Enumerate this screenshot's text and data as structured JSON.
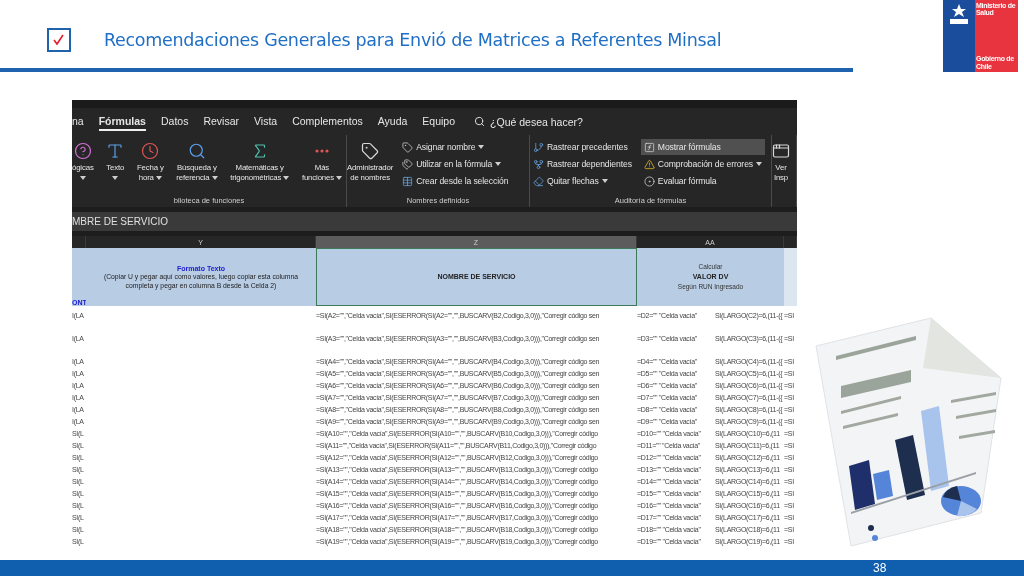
{
  "slide": {
    "title": "Recomendaciones Generales para Envió de Matrices a Referentes Minsal",
    "page_number": "38"
  },
  "logo": {
    "top_text": "Ministerio de Salud",
    "bottom_text": "Gobierno de Chile"
  },
  "excel": {
    "ribbon_tabs": [
      {
        "label": "na",
        "selected": false
      },
      {
        "label": "Fórmulas",
        "selected": true
      },
      {
        "label": "Datos",
        "selected": false
      },
      {
        "label": "Revisar",
        "selected": false
      },
      {
        "label": "Vista",
        "selected": false
      },
      {
        "label": "Complementos",
        "selected": false
      },
      {
        "label": "Ayuda",
        "selected": false
      },
      {
        "label": "Equipo",
        "selected": false
      }
    ],
    "search_placeholder": "¿Qué desea hacer?",
    "groups": [
      {
        "label": "blioteca de funciones",
        "items": [
          {
            "kind": "large",
            "lines": [
              "ógicas"
            ],
            "dropdown": true
          },
          {
            "kind": "large",
            "lines": [
              "Texto"
            ],
            "dropdown": true
          },
          {
            "kind": "large",
            "lines": [
              "Fecha y",
              "hora"
            ],
            "dropdown": true
          },
          {
            "kind": "large",
            "lines": [
              "Búsqueda y",
              "referencia"
            ],
            "dropdown": true
          },
          {
            "kind": "large",
            "lines": [
              "Matemáticas y",
              "trigonométricas"
            ],
            "dropdown": true
          },
          {
            "kind": "large",
            "lines": [
              "Más",
              "funciones"
            ],
            "dropdown": true
          }
        ]
      },
      {
        "label": "Nombres definidos",
        "items": [
          {
            "kind": "large",
            "lines": [
              "Administrador",
              "de nombres"
            ],
            "dropdown": false
          },
          {
            "kind": "small",
            "label": "Asignar nombre",
            "dropdown": true,
            "selected": false
          },
          {
            "kind": "small",
            "label": "Utilizar en la fórmula",
            "dropdown": true,
            "selected": false
          },
          {
            "kind": "small",
            "label": "Crear desde la selección",
            "dropdown": false,
            "selected": false
          }
        ]
      },
      {
        "label": "Auditoría de fórmulas",
        "items": [
          {
            "kind": "small",
            "label": "Rastrear precedentes",
            "dropdown": false,
            "selected": false
          },
          {
            "kind": "small",
            "label": "Rastrear dependientes",
            "dropdown": false,
            "selected": false
          },
          {
            "kind": "small",
            "label": "Quitar flechas",
            "dropdown": true,
            "selected": false
          },
          {
            "kind": "small",
            "label": "Mostrar fórmulas",
            "dropdown": false,
            "selected": true
          },
          {
            "kind": "small",
            "label": "Comprobación de errores",
            "dropdown": true,
            "selected": false
          },
          {
            "kind": "small",
            "label": "Evaluar fórmula",
            "dropdown": false,
            "selected": false
          }
        ]
      },
      {
        "items": [
          {
            "kind": "large",
            "lines": [
              "Ver",
              "Insp"
            ],
            "dropdown": false
          }
        ]
      }
    ],
    "name_box": "MBRE DE SERVICIO",
    "columns": [
      {
        "label": "Y",
        "selected": false
      },
      {
        "label": "Z",
        "selected": true
      },
      {
        "label": "AA",
        "selected": false
      }
    ],
    "header_row": {
      "stub": "ONT",
      "y_title": "Formato Texto",
      "y_note": "(Copiar U y pegar aquí como valores, luego copiar esta columna completa y pegar en columna B desde la Celda 2)",
      "z": "NOMBRE DE SERVICIO",
      "aa": [
        "Calcular",
        "VALOR DV",
        "Según RUN Ingresado"
      ]
    },
    "rows": [
      {
        "tall": true,
        "cells": [
          "I(LA",
          "=SI(A2=\"\",\"Celda vacía\",SI(ESERROR(SI(A2=\"\",\"\",BUSCARV(B2,Codigo,3,0))),\"Corregir código sen",
          "=D2=\"\" \"Celda vacía\"",
          "SI(LARGO(C2)=6,(11-({",
          "=SI"
        ]
      },
      {
        "tall": true,
        "cells": [
          "I(LA",
          "=SI(A3=\"\",\"Celda vacía\",SI(ESERROR(SI(A3=\"\",\"\",BUSCARV(B3,Codigo,3,0))),\"Corregir código sen",
          "=D3=\"\" \"Celda vacía\"",
          "SI(LARGO(C3)=6,(11-({",
          "=SI"
        ]
      },
      {
        "tall": false,
        "cells": [
          "I(LA",
          "=SI(A4=\"\",\"Celda vacía\",SI(ESERROR(SI(A4=\"\",\"\",BUSCARV(B4,Codigo,3,0))),\"Corregir código sen",
          "=D4=\"\" \"Celda vacía\"",
          "SI(LARGO(C4)=6,(11-({",
          "=SI"
        ]
      },
      {
        "tall": false,
        "cells": [
          "I(LA",
          "=SI(A5=\"\",\"Celda vacía\",SI(ESERROR(SI(A5=\"\",\"\",BUSCARV(B5,Codigo,3,0))),\"Corregir código sen",
          "=D5=\"\" \"Celda vacía\"",
          "SI(LARGO(C5)=6,(11-({",
          "=SI"
        ]
      },
      {
        "tall": false,
        "cells": [
          "I(LA",
          "=SI(A6=\"\",\"Celda vacía\",SI(ESERROR(SI(A6=\"\",\"\",BUSCARV(B6,Codigo,3,0))),\"Corregir código sen",
          "=D6=\"\" \"Celda vacía\"",
          "SI(LARGO(C6)=6,(11-({",
          "=SI"
        ]
      },
      {
        "tall": false,
        "cells": [
          "I(LA",
          "=SI(A7=\"\",\"Celda vacía\",SI(ESERROR(SI(A7=\"\",\"\",BUSCARV(B7,Codigo,3,0))),\"Corregir código sen",
          "=D7=\"\" \"Celda vacía\"",
          "SI(LARGO(C7)=6,(11-({",
          "=SI"
        ]
      },
      {
        "tall": false,
        "cells": [
          "I(LA",
          "=SI(A8=\"\",\"Celda vacía\",SI(ESERROR(SI(A8=\"\",\"\",BUSCARV(B8,Codigo,3,0))),\"Corregir código sen",
          "=D8=\"\" \"Celda vacía\"",
          "SI(LARGO(C8)=6,(11-({",
          "=SI"
        ]
      },
      {
        "tall": false,
        "cells": [
          "I(LA",
          "=SI(A9=\"\",\"Celda vacía\",SI(ESERROR(SI(A9=\"\",\"\",BUSCARV(B9,Codigo,3,0))),\"Corregir código sen",
          "=D9=\"\" \"Celda vacía\"",
          "SI(LARGO(C9)=6,(11-({",
          "=SI"
        ]
      },
      {
        "tall": false,
        "cells": [
          "SI(L",
          "=SI(A10=\"\",\"Celda vacía\",SI(ESERROR(SI(A10=\"\",\"\",BUSCARV(B10,Codigo,3,0))),\"Corregir código",
          "=D10=\"\" \"Celda vacía\"",
          "SI(LARGO(C10)=6,(11",
          "=SI"
        ]
      },
      {
        "tall": false,
        "cells": [
          "SI(L",
          "=SI(A11=\"\",\"Celda vacía\",SI(ESERROR(SI(A11=\"\",\"\",BUSCARV(B11,Codigo,3,0))),\"Corregir código",
          "=D11=\"\" \"Celda vacía\"",
          "SI(LARGO(C11)=6,(11",
          "=SI"
        ]
      },
      {
        "tall": false,
        "cells": [
          "SI(L",
          "=SI(A12=\"\",\"Celda vacía\",SI(ESERROR(SI(A12=\"\",\"\",BUSCARV(B12,Codigo,3,0))),\"Corregir código",
          "=D12=\"\" \"Celda vacía\"",
          "SI(LARGO(C12)=6,(11",
          "=SI"
        ]
      },
      {
        "tall": false,
        "cells": [
          "SI(L",
          "=SI(A13=\"\",\"Celda vacía\",SI(ESERROR(SI(A13=\"\",\"\",BUSCARV(B13,Codigo,3,0))),\"Corregir código",
          "=D13=\"\" \"Celda vacía\"",
          "SI(LARGO(C13)=6,(11",
          "=SI"
        ]
      },
      {
        "tall": false,
        "cells": [
          "SI(L",
          "=SI(A14=\"\",\"Celda vacía\",SI(ESERROR(SI(A14=\"\",\"\",BUSCARV(B14,Codigo,3,0))),\"Corregir código",
          "=D14=\"\" \"Celda vacía\"",
          "SI(LARGO(C14)=6,(11",
          "=SI"
        ]
      },
      {
        "tall": false,
        "cells": [
          "SI(L",
          "=SI(A15=\"\",\"Celda vacía\",SI(ESERROR(SI(A15=\"\",\"\",BUSCARV(B15,Codigo,3,0))),\"Corregir código",
          "=D15=\"\" \"Celda vacía\"",
          "SI(LARGO(C15)=6,(11",
          "=SI"
        ]
      },
      {
        "tall": false,
        "cells": [
          "SI(L",
          "=SI(A16=\"\",\"Celda vacía\",SI(ESERROR(SI(A16=\"\",\"\",BUSCARV(B16,Codigo,3,0))),\"Corregir código",
          "=D16=\"\" \"Celda vacía\"",
          "SI(LARGO(C16)=6,(11",
          "=SI"
        ]
      },
      {
        "tall": false,
        "cells": [
          "SI(L",
          "=SI(A17=\"\",\"Celda vacía\",SI(ESERROR(SI(A17=\"\",\"\",BUSCARV(B17,Codigo,3,0))),\"Corregir código",
          "=D17=\"\" \"Celda vacía\"",
          "SI(LARGO(C17)=6,(11",
          "=SI"
        ]
      },
      {
        "tall": false,
        "cells": [
          "SI(L",
          "=SI(A18=\"\",\"Celda vacía\",SI(ESERROR(SI(A18=\"\",\"\",BUSCARV(B18,Codigo,3,0))),\"Corregir código",
          "=D18=\"\" \"Celda vacía\"",
          "SI(LARGO(C18)=6,(11",
          "=SI"
        ]
      },
      {
        "tall": false,
        "cells": [
          "SI(L",
          "=SI(A19=\"\",\"Celda vacía\",SI(ESERROR(SI(A19=\"\",\"\",BUSCARV(B19,Codigo,3,0))),\"Corregir código",
          "=D19=\"\" \"Celda vacía\"",
          "SI(LARGO(C19)=6,(11",
          "=SI"
        ]
      }
    ]
  }
}
